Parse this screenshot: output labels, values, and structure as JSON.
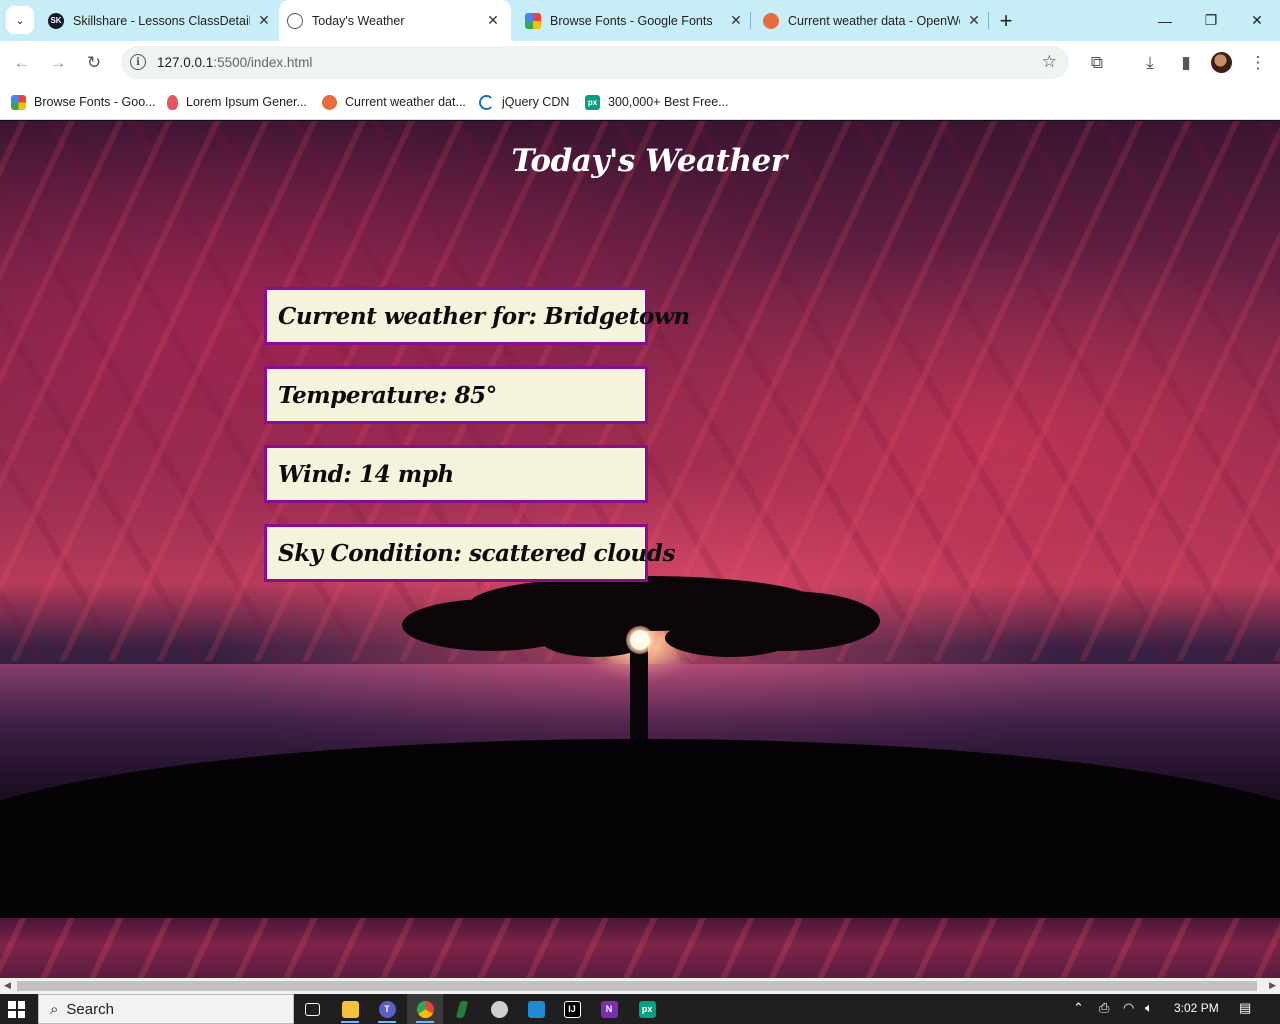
{
  "browser": {
    "tabs": [
      {
        "title": "Skillshare - Lessons ClassDetails",
        "favicon": "skillshare-icon",
        "favicon_text": "SK",
        "active": false
      },
      {
        "title": "Today's Weather",
        "favicon": "globe-icon",
        "active": true
      },
      {
        "title": "Browse Fonts - Google Fonts",
        "favicon": "google-fonts-icon",
        "active": false
      },
      {
        "title": "Current weather data - OpenWeatherMap",
        "favicon": "openweather-icon",
        "active": false
      }
    ],
    "new_tab": "+",
    "window_controls": {
      "minimize": "—",
      "restore": "❐",
      "close": "✕"
    },
    "url_host": "127.0.0.1",
    "url_path": ":5500/index.html",
    "bookmarks": [
      {
        "label": "Browse Fonts - Goo...",
        "icon": "google-fonts-icon"
      },
      {
        "label": "Lorem Ipsum Gener...",
        "icon": "lorem-ipsum-icon"
      },
      {
        "label": "Current weather dat...",
        "icon": "openweather-icon"
      },
      {
        "label": "jQuery CDN",
        "icon": "jquery-icon"
      },
      {
        "label": "300,000+ Best Free...",
        "icon": "pexels-icon",
        "icon_text": "px"
      }
    ]
  },
  "page": {
    "title": "Today's Weather",
    "cards": {
      "location": "Current weather for: Bridgetown",
      "temperature": "Temperature: 85°",
      "wind": "Wind: 14 mph",
      "sky": "Sky Condition: scattered clouds"
    },
    "colors": {
      "card_bg": "#f5f3dc",
      "card_border": "#8a0d8f",
      "title_color": "#ffffff"
    }
  },
  "taskbar": {
    "search_label": "Search",
    "apps": [
      "task-view-icon",
      "file-explorer-icon",
      "teams-icon",
      "chrome-icon",
      "app-icon",
      "obs-icon",
      "vscode-icon",
      "intellij-icon",
      "onenote-icon",
      "pexels-icon"
    ],
    "time": "3:02 PM"
  }
}
